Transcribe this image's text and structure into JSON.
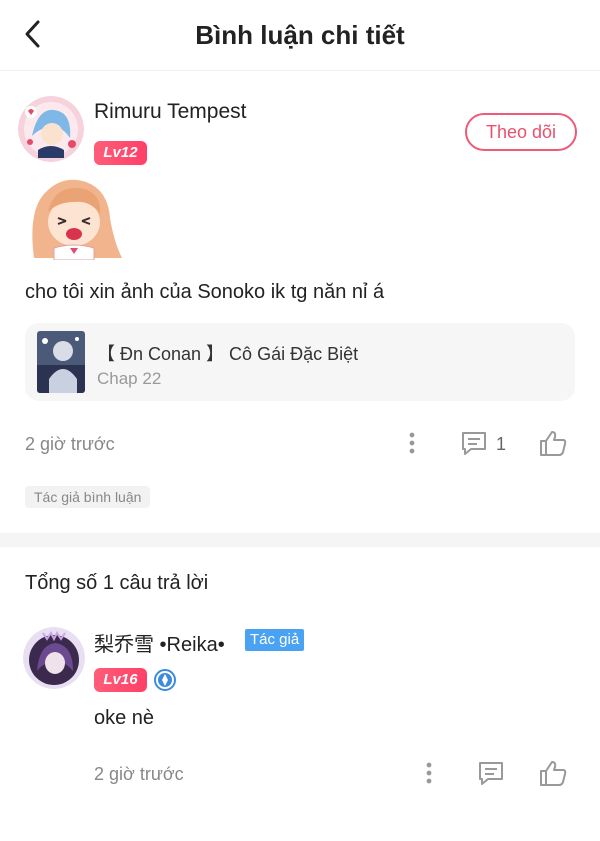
{
  "header": {
    "title": "Bình luận chi tiết",
    "back_icon": "chevron-left-icon"
  },
  "comment": {
    "user_name": "Rimuru Tempest",
    "level": "Lv12",
    "follow_label": "Theo dõi",
    "text": "cho tôi xin ảnh của Sonoko ik tg năn nỉ á",
    "card": {
      "title": "【 Đn Conan 】 Cô Gái Đặc Biệt",
      "subtitle": "Chap 22"
    },
    "time": "2 giờ trước",
    "reply_count": "1",
    "tag": "Tác giả bình luận"
  },
  "replies": {
    "total_label": "Tổng số 1 câu trả lời",
    "items": [
      {
        "user_name": "梨乔雪 •Reika•",
        "author_tag": "Tác giả",
        "level": "Lv16",
        "text": "oke nè",
        "time": "2 giờ trước"
      }
    ]
  },
  "colors": {
    "accent": "#ee5a78",
    "author_blue": "#4aa3f2",
    "divider": "#f5f5f5"
  }
}
